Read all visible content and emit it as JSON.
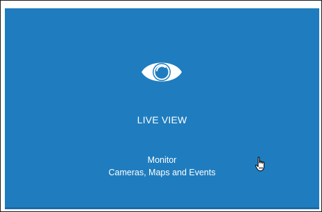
{
  "tile": {
    "title": "LIVE VIEW",
    "description_line1": "Monitor",
    "description_line2": "Cameras, Maps and Events",
    "icon": "eye-icon",
    "background_color": "#1f7dbf"
  },
  "cursor": {
    "icon": "hand-pointer-icon"
  }
}
